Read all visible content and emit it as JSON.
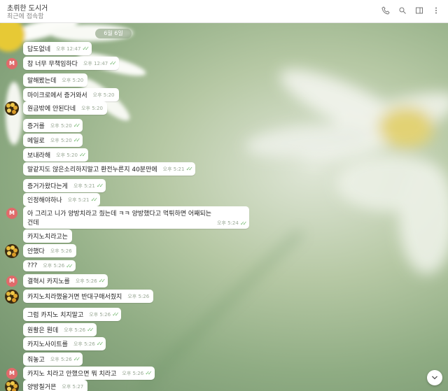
{
  "header": {
    "title": "초뤼한 도시거",
    "subtitle": "최근에 접속함"
  },
  "date_pill": "6월 6일",
  "messages": [
    {
      "text": "답도없네",
      "time": "오후 12:47",
      "read": true
    },
    {
      "text": "참 너무 무책임하다",
      "time": "오후 12:47",
      "read": true,
      "avatar": "M"
    },
    {
      "text": "말해봤는데",
      "time": "오후 5:20",
      "read": false
    },
    {
      "text": "마이크로에서 증거와서",
      "time": "오후 5:20",
      "read": false
    },
    {
      "text": "원금밖에 안된다네",
      "time": "오후 5:20",
      "read": false,
      "avatar": "emoji"
    },
    {
      "text": "증거를",
      "time": "오후 5:20",
      "read": true
    },
    {
      "text": "메일로",
      "time": "오후 5:20",
      "read": true
    },
    {
      "text": "보내라해",
      "time": "오후 5:20",
      "read": true
    },
    {
      "text": "말같지도 않은소리하지말고 환전누른지 40분만에",
      "time": "오후 5:21",
      "read": true
    },
    {
      "text": "증거가왔다는게",
      "time": "오후 5:21",
      "read": true
    },
    {
      "text": "인정해야하나",
      "time": "오후 5:21",
      "read": true
    },
    {
      "text": "아 그리고 니가 양방치라고 줬는데 ㅋㅋ 양방했다고 먹튀하면 어째되는",
      "text2": "건데",
      "time": "오후 5:24",
      "read": true,
      "avatar": "M"
    },
    {
      "text": "카지노치라고는",
      "time": "",
      "read": false
    },
    {
      "text": "안했다",
      "time": "오후 5:26",
      "read": false,
      "avatar": "emoji"
    },
    {
      "text": "???",
      "time": "오후 5:26",
      "read": true
    },
    {
      "text": "결혁시 카지노를",
      "time": "오후 5:26",
      "read": true,
      "avatar": "M"
    },
    {
      "text": "카지노치라했을거면 반대구매서줬지",
      "time": "오후 5:26",
      "read": false,
      "avatar": "emoji"
    },
    {
      "text": "그럼 카지노 치지말고",
      "time": "오후 5:26",
      "read": true
    },
    {
      "text": "원활은 뭔데",
      "time": "오후 5:26",
      "read": true
    },
    {
      "text": "카지노사이트를",
      "time": "오후 5:26",
      "read": true
    },
    {
      "text": "줘놓고",
      "time": "오후 5:26",
      "read": true
    },
    {
      "text": "카지노 치라고 안했으면 뭐 치라고",
      "time": "오후 5:26",
      "read": true,
      "avatar": "M"
    },
    {
      "text": "양방칠거믄",
      "time": "오후 5:27",
      "read": false,
      "avatar": "emoji"
    }
  ],
  "icons": {
    "call": "phone-icon",
    "search": "search-icon",
    "sidebar": "sidebar-icon",
    "more": "more-vertical-icon",
    "scroll": "chevron-down-icon"
  },
  "colors": {
    "tick": "#6fb66b",
    "avatar_m": "#e06a6a"
  }
}
